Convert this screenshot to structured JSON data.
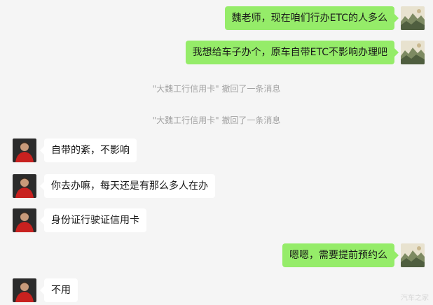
{
  "messages": [
    {
      "side": "me",
      "text": "魏老师，现在咱们行办ETC的人多么"
    },
    {
      "side": "me",
      "text": "我想给车子办个，原车自带ETC不影响办理吧"
    },
    {
      "side": "system",
      "text": "\"大魏工行信用卡\" 撤回了一条消息"
    },
    {
      "side": "system",
      "text": "\"大魏工行信用卡\" 撤回了一条消息"
    },
    {
      "side": "other",
      "text": "自带的紊，不影响"
    },
    {
      "side": "other",
      "text": "你去办嘛，每天还是有那么多人在办"
    },
    {
      "side": "other",
      "text": "身份证行驶证信用卡"
    },
    {
      "side": "me",
      "text": "嗯嗯，需要提前预约么"
    },
    {
      "side": "other",
      "text": "不用"
    }
  ],
  "watermark": "汽车之家",
  "colors": {
    "background": "#f5f5f5",
    "my_bubble": "#95ec69",
    "other_bubble": "#ffffff",
    "system_text": "#a3a3a3"
  },
  "icons": {
    "my_avatar": "landscape-painting-avatar",
    "other_avatar": "person-red-shirt-avatar"
  }
}
